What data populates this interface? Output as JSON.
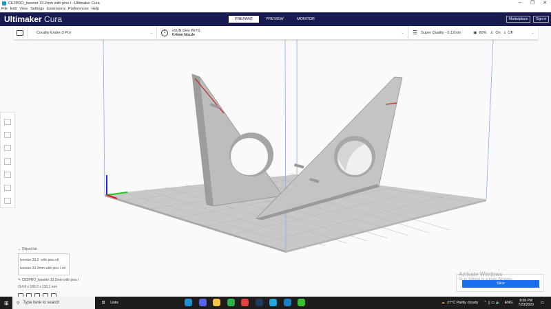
{
  "window": {
    "title": "CE3PRO_tweeter 33.2mm with pins I - Ultimaker Cura",
    "controls": [
      "–",
      "❐",
      "✕"
    ]
  },
  "menu": [
    "File",
    "Edit",
    "View",
    "Settings",
    "Extensions",
    "Preferences",
    "Help"
  ],
  "header": {
    "brand_bold": "Ultimaker",
    "brand_light": "Cura",
    "stages": [
      "PREPARE",
      "PREVIEW",
      "MONITOR"
    ],
    "active_stage": "PREPARE",
    "marketplace": "Marketplace",
    "signin": "Sign in"
  },
  "toolbar": {
    "printer": "Creality Ender-3 Pro",
    "material": "eSUN Grey PETG",
    "nozzle": "0.4mm Nozzle",
    "extruder": "1",
    "profile": "Super Quality - 0.12mm",
    "infill": "60%",
    "support": "On",
    "adhesion": "Off"
  },
  "object_list": {
    "title": "Object list",
    "items": [
      "tweeter 33.2. with pins.stl",
      "tweeter 33.2mm with pins I.stl"
    ],
    "job_name": "CE3PRO_tweeter 33.2mm with pins I",
    "dimensions": "114.6 x 180.2 x 110.1 mm"
  },
  "slice": {
    "label": "Slice"
  },
  "watermark": {
    "title": "Activate Windows",
    "sub": "Go to Settings to activate Windows."
  },
  "taskbar": {
    "search_placeholder": "Type here to search",
    "links": "Links",
    "weather": "27°C  Partly cloudy",
    "lang": "ENG",
    "time": "8:08 PM",
    "date": "7/23/2023"
  }
}
